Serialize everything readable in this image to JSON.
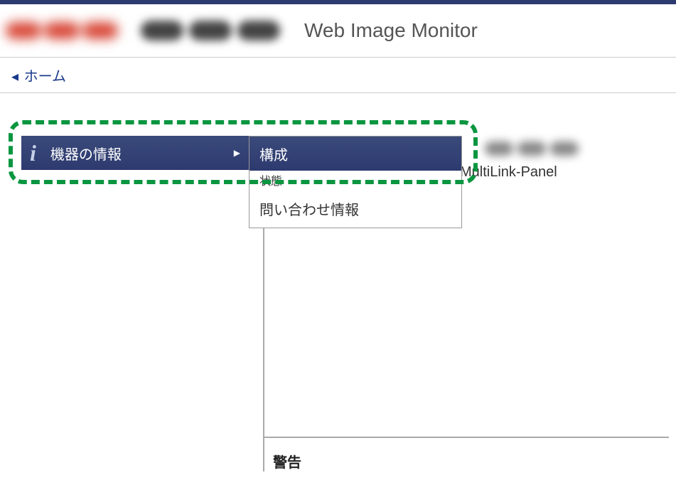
{
  "header": {
    "app_title": "Web Image Monitor"
  },
  "breadcrumb": {
    "home_label": "ホーム"
  },
  "menu": {
    "main_item": {
      "label": "機器の情報"
    },
    "submenu": [
      {
        "label": "構成",
        "highlighted": true
      },
      {
        "label": "状態",
        "partial": true
      },
      {
        "label": "問い合わせ情報"
      }
    ]
  },
  "panel": {
    "multilink_label": "MultiLink-Panel",
    "warning_label": "警告"
  }
}
